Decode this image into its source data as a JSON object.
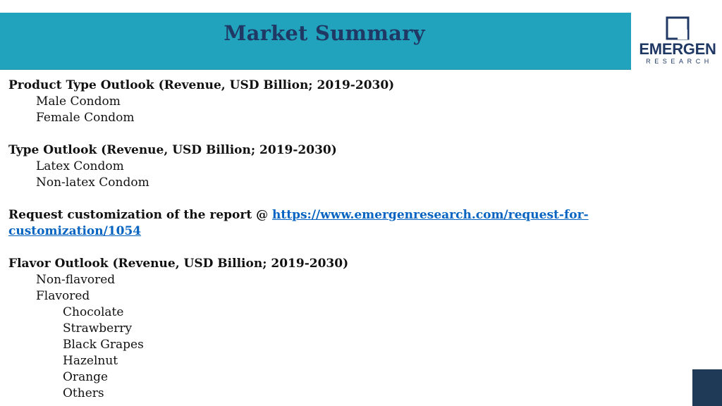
{
  "header": {
    "title": "Market Summary"
  },
  "logo": {
    "name": "EMERGEN",
    "sub": "RESEARCH"
  },
  "sections": {
    "product_type": {
      "heading": "Product Type Outlook (Revenue, USD Billion; 2019-2030)",
      "items": [
        "Male Condom",
        "Female Condom"
      ]
    },
    "type": {
      "heading": "Type Outlook (Revenue, USD Billion; 2019-2030)",
      "items": [
        "Latex Condom",
        "Non-latex Condom"
      ]
    },
    "request": {
      "prefix": "Request customization of the report @ ",
      "link_part1": "https://www.emergenresearch.com/request-for-",
      "link_part2": "customization/1054"
    },
    "flavor": {
      "heading": "Flavor Outlook (Revenue, USD Billion; 2019-2030)",
      "items": [
        "Non-flavored",
        "Flavored"
      ],
      "flavored_sub": [
        "Chocolate",
        "Strawberry",
        "Black Grapes",
        "Hazelnut",
        "Orange",
        "Others"
      ]
    }
  },
  "colors": {
    "header_bar": "#22a3bd",
    "title": "#1f3864",
    "link": "#0563c1",
    "corner_box": "#1f3a56"
  }
}
